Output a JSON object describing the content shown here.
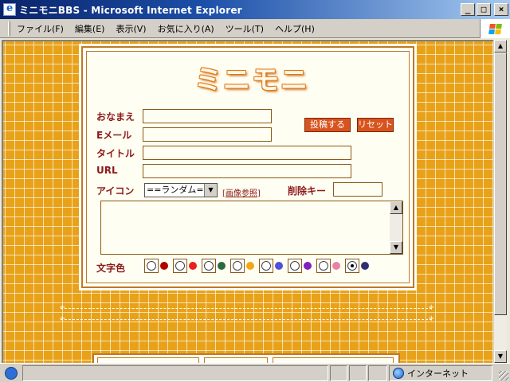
{
  "window": {
    "title": "ミニモニBBS - Microsoft Internet Explorer",
    "buttons": {
      "minimize": "_",
      "maximize": "□",
      "close": "×"
    }
  },
  "menu": {
    "items": [
      {
        "label": "ファイル(F)"
      },
      {
        "label": "編集(E)"
      },
      {
        "label": "表示(V)"
      },
      {
        "label": "お気に入り(A)"
      },
      {
        "label": "ツール(T)"
      },
      {
        "label": "ヘルプ(H)"
      }
    ]
  },
  "form": {
    "logo_text": "ミニモニ",
    "name_label": "おなまえ",
    "email_label": "Eメール",
    "title_label": "タイトル",
    "url_label": "URL",
    "icon_label": "アイコン",
    "icon_select_value": "==ランダム==",
    "image_ref_link": "画像参照",
    "delete_key_label": "削除キー",
    "submit_label": "投稿する",
    "reset_label": "リセット",
    "text_color_label": "文字色",
    "name_value": "",
    "email_value": "",
    "title_value": "",
    "url_value": "",
    "delete_key_value": "",
    "message_value": ""
  },
  "colors": {
    "selected_index": 7,
    "options": [
      "#b00000",
      "#e82020",
      "#2a6a40",
      "#f0a818",
      "#5050d8",
      "#8020c0",
      "#e880a8",
      "#303070"
    ],
    "brand_orange": "#e8a21a",
    "label_color": "#8b1a1a",
    "button_color": "#d9531e"
  },
  "status": {
    "zone_label": "インターネット"
  }
}
